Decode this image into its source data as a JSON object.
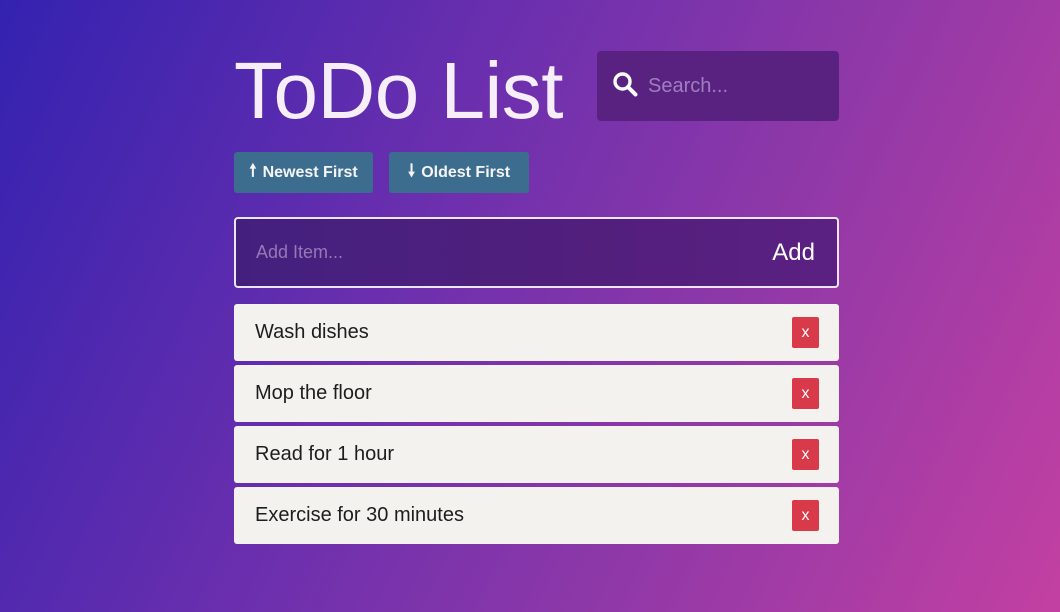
{
  "header": {
    "title": "ToDo List",
    "search": {
      "placeholder": "Search...",
      "value": "",
      "icon": "search-icon"
    }
  },
  "sort": {
    "newest": {
      "arrow": "🠕",
      "label": "Newest First"
    },
    "oldest": {
      "arrow": "🠗",
      "label": "Oldest First"
    }
  },
  "add_form": {
    "placeholder": "Add Item...",
    "value": "",
    "button_label": "Add"
  },
  "items": [
    {
      "label": "Wash dishes",
      "delete_label": "x"
    },
    {
      "label": "Mop the floor",
      "delete_label": "x"
    },
    {
      "label": "Read for 1 hour",
      "delete_label": "x"
    },
    {
      "label": "Exercise for 30 minutes",
      "delete_label": "x"
    }
  ],
  "colors": {
    "sort_button": "#3d6d8e",
    "delete_button": "#d93a4a",
    "item_background": "#f4f2ee",
    "search_background": "#5a2280"
  }
}
